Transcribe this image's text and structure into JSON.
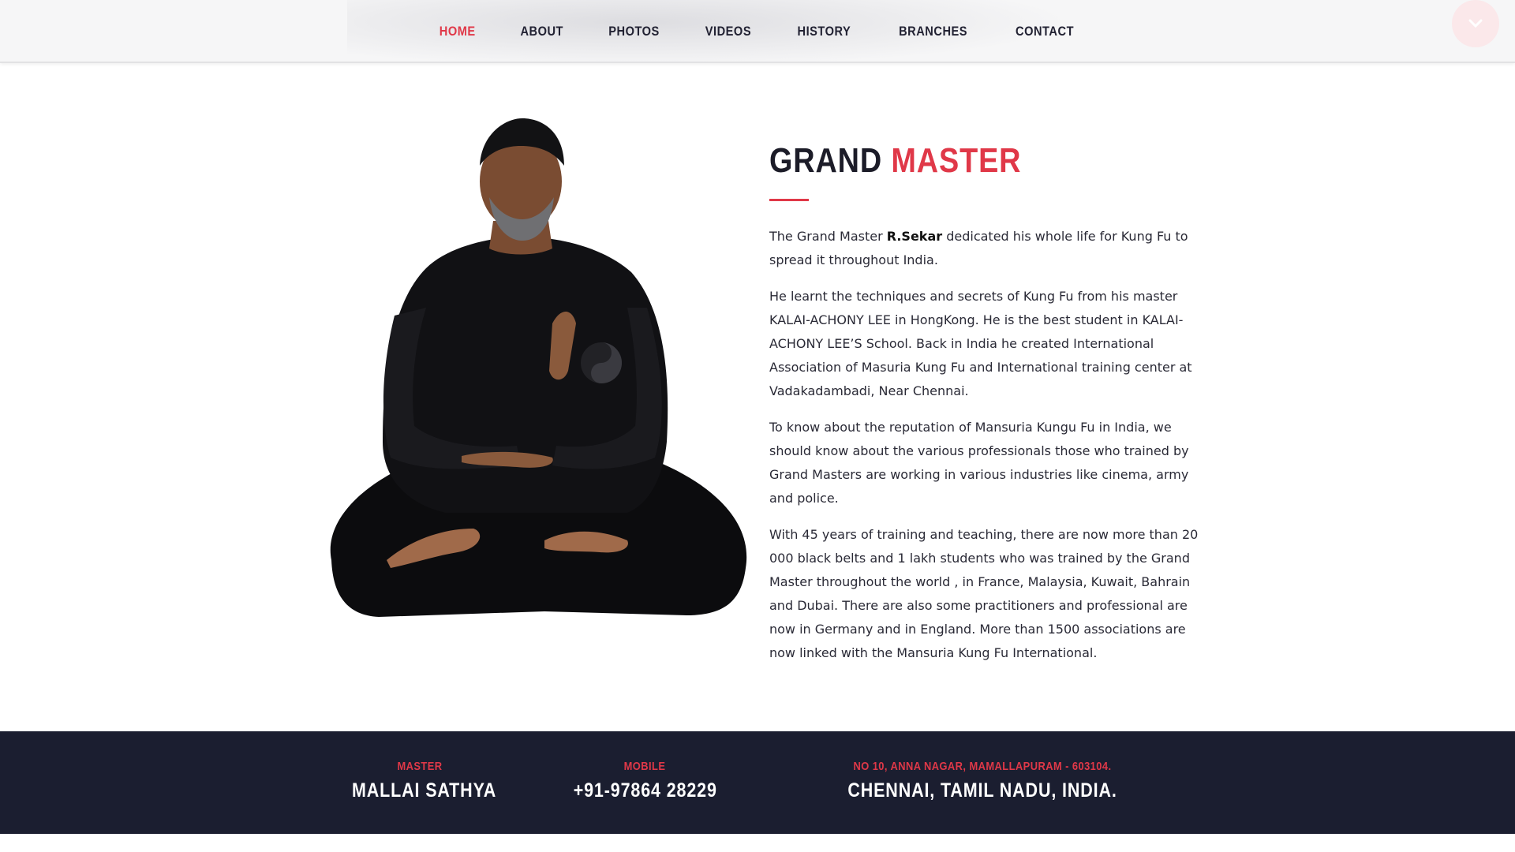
{
  "nav": {
    "items": [
      {
        "label": "HOME",
        "active": true
      },
      {
        "label": "ABOUT",
        "active": false
      },
      {
        "label": "PHOTOS",
        "active": false
      },
      {
        "label": "VIDEOS",
        "active": false
      },
      {
        "label": "HISTORY",
        "active": false
      },
      {
        "label": "BRANCHES",
        "active": false
      },
      {
        "label": "CONTACT",
        "active": false
      }
    ],
    "toggle_icon": "chevron-down-icon"
  },
  "hero": {
    "title_dark": "GRAND",
    "title_accent": "MASTER",
    "p1_prefix": "The Grand Master ",
    "p1_bold": "R.Sekar",
    "p1_suffix": " dedicated his whole life for Kung Fu to spread it throughout India.",
    "p2": "He learnt the techniques and secrets of Kung Fu from his master KALAI-ACHONY LEE in HongKong. He is the best student in KALAI-ACHONY LEE’S School. Back in India he created International Association of Masuria Kung Fu and International training center at Vadakadambadi, Near Chennai.",
    "p3": "To know about the reputation of Mansuria Kungu Fu in India, we should know about the various professionals those who trained by Grand Masters are working in various industries like cinema, army and police.",
    "p4": "With 45 years of training and teaching, there are now more than 20 000 black belts and 1 lakh students who was trained by the Grand Master throughout the world , in France, Malaysia, Kuwait, Bahrain and Dubai. There are also some practitioners and professional are now in Germany and in England. More than 1500 associations are now linked with the Mansuria Kung Fu International."
  },
  "footer": {
    "master_label": "MASTER",
    "master_value": "MALLAI SATHYA",
    "mobile_label": "MOBILE",
    "mobile_value": "+91-97864 28229",
    "address_label": "NO 10, ANNA NAGAR, MAMALLAPURAM - 603104.",
    "address_value": "CHENNAI, TAMIL NADU, INDIA."
  },
  "colors": {
    "accent": "#e03848",
    "footer_bg": "#1b1e30",
    "text_dark": "#1c1c28"
  }
}
